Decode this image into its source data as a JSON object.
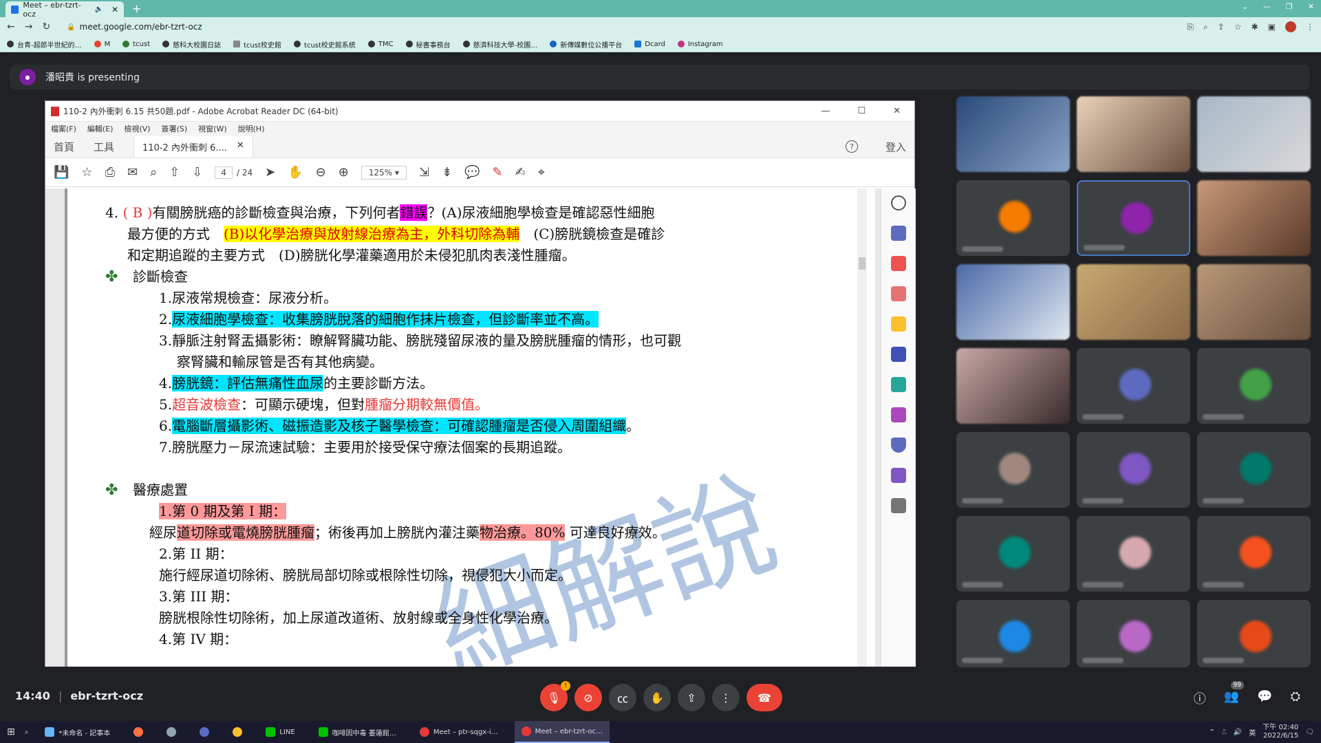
{
  "browser": {
    "tab_title": "Meet – ebr-tzrt-ocz",
    "url": "meet.google.com/ebr-tzrt-ocz",
    "bookmarks": [
      "台青-超郎半世紀的…",
      "M",
      "tcust",
      "慈科大校園日誌",
      "tcust校史館",
      "tcust校史館系統",
      "TMC",
      "秘書事務台",
      "慈濟科技大學-校園…",
      "新傳媒數位公播平台",
      "Dcard",
      "Instagram"
    ]
  },
  "meet": {
    "presenter_label": "潘昭貴 is presenting",
    "meeting_code": "ebr-tzrt-ocz",
    "time": "14:40",
    "participants_badge": "99"
  },
  "acrobat": {
    "title": "110-2 內外衝刺 6.15 共50題.pdf - Adobe Acrobat Reader DC (64-bit)",
    "menu": [
      "檔案(F)",
      "編輯(E)",
      "檢視(V)",
      "簽署(S)",
      "視窗(W)",
      "說明(H)"
    ],
    "tab_home": "首頁",
    "tab_tools": "工具",
    "doc_tab": "110-2 內外衝刺 6....",
    "sign_in": "登入",
    "page_current": "4",
    "page_total": "/ 24",
    "zoom": "125%"
  },
  "doc": {
    "q_num": "4.",
    "q_answer": "( B )",
    "q_text1": "有關膀胱癌的診斷檢查與治療，下列何者",
    "q_wrong": "錯誤",
    "q_text2": "？(A)尿液細胞學檢查是確認惡性細胞",
    "q_text3": "最方便的方式",
    "q_optB": "(B)以化學治療與放射線治療為主，外科切除為輔",
    "q_optC": "(C)膀胱鏡檢查是確診",
    "q_text4": "和定期追蹤的主要方式　(D)膀胱化學灌藥適用於未侵犯肌肉表淺性腫瘤。",
    "sec1": "診斷檢查",
    "d1": "1.尿液常規檢查：尿液分析。",
    "d2_num": "2.",
    "d2": "尿液細胞學檢查：收集膀胱脫落的細胞作抹片檢查，但診斷率並不高。",
    "d3a": "3.靜脈注射腎盂攝影術：瞭解腎臟功能、膀胱殘留尿液的量及膀胱腫瘤的情形，也可觀",
    "d3b": "察腎臟和輸尿管是否有其他病變。",
    "d4_num": "4.",
    "d4_hl": "膀胱鏡：評估無痛性血尿",
    "d4_rest": "的主要診斷方法。",
    "d5_num": "5.",
    "d5_red": "超音波檢查",
    "d5_mid": "：可顯示硬塊，但對",
    "d5_red2": "腫瘤分期較無價值",
    "d5_end": "。",
    "d6_num": "6.",
    "d6_hl": "電腦斷層攝影術、磁振造影及核子醫學檢查：可確認腫瘤是否侵入周圍組織",
    "d6_end": "。",
    "d7": "7.膀胱壓力－尿流速試驗：主要用於接受保守療法個案的長期追蹤。",
    "sec2": "醫療處置",
    "t1": "1.第 0 期及第 I 期：",
    "t1a_pre": "經尿",
    "t1a_hl": "道切除或電燒膀胱腫瘤",
    "t1a_mid": "；術後再加上膀胱內灌注藥",
    "t1a_hl2": "物治療。80%",
    "t1a_end": " 可達良好療效。",
    "t2": "2.第 II 期：",
    "t2a": "施行經尿道切除術、膀胱局部切除或根除性切除，視侵犯大小而定。",
    "t3": "3.第 III 期：",
    "t3a": "膀胱根除性切除術，加上尿道改道術、放射線或全身性化學治療。",
    "t4": "4.第 IV 期：",
    "watermark": "細解說"
  },
  "taskbar": {
    "items": [
      "*未命名 - 記事本",
      "LINE",
      "咖啡因中毒 萎蓮館…",
      "Meet – ptr-sqgx-i…",
      "Meet – ebr-tzrt-oc…"
    ],
    "clock_time": "下午 02:40",
    "clock_date": "2022/6/15",
    "lang": "英"
  }
}
